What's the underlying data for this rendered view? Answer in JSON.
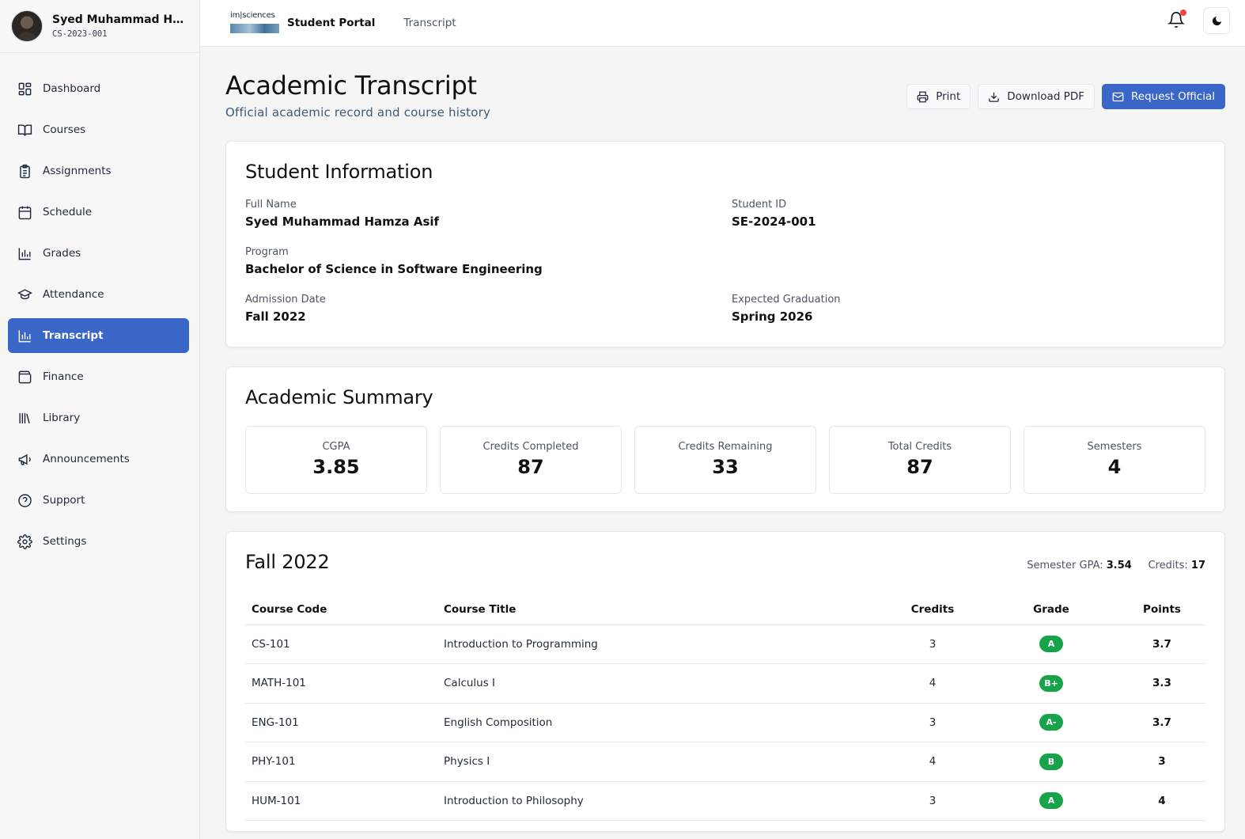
{
  "user": {
    "name": "Syed Muhammad Hamz...",
    "id": "CS-2023-001"
  },
  "sidebar": {
    "items": [
      {
        "label": "Dashboard",
        "icon": "dashboard-icon"
      },
      {
        "label": "Courses",
        "icon": "book-icon"
      },
      {
        "label": "Assignments",
        "icon": "clipboard-icon"
      },
      {
        "label": "Schedule",
        "icon": "calendar-icon"
      },
      {
        "label": "Grades",
        "icon": "bar-chart-icon"
      },
      {
        "label": "Attendance",
        "icon": "graduation-cap-icon"
      },
      {
        "label": "Transcript",
        "icon": "bar-chart-icon",
        "active": true
      },
      {
        "label": "Finance",
        "icon": "wallet-icon"
      },
      {
        "label": "Library",
        "icon": "library-icon"
      },
      {
        "label": "Announcements",
        "icon": "megaphone-icon"
      },
      {
        "label": "Support",
        "icon": "help-circle-icon"
      },
      {
        "label": "Settings",
        "icon": "gear-icon"
      }
    ]
  },
  "header": {
    "logo_text": "im|sciences",
    "portal_title": "Student Portal",
    "breadcrumb": "Transcript"
  },
  "page": {
    "title": "Academic Transcript",
    "subtitle": "Official academic record and course history",
    "actions": {
      "print": "Print",
      "download": "Download PDF",
      "request": "Request Official"
    }
  },
  "student_info": {
    "title": "Student Information",
    "full_name_label": "Full Name",
    "full_name": "Syed Muhammad Hamza Asif",
    "student_id_label": "Student ID",
    "student_id": "SE-2024-001",
    "program_label": "Program",
    "program": "Bachelor of Science in Software Engineering",
    "admission_label": "Admission Date",
    "admission": "Fall 2022",
    "graduation_label": "Expected Graduation",
    "graduation": "Spring 2026"
  },
  "summary": {
    "title": "Academic Summary",
    "stats": [
      {
        "label": "CGPA",
        "value": "3.85"
      },
      {
        "label": "Credits Completed",
        "value": "87"
      },
      {
        "label": "Credits Remaining",
        "value": "33"
      },
      {
        "label": "Total Credits",
        "value": "87"
      },
      {
        "label": "Semesters",
        "value": "4"
      }
    ]
  },
  "semester": {
    "title": "Fall 2022",
    "gpa_label": "Semester GPA:",
    "gpa": "3.54",
    "credits_label": "Credits:",
    "credits": "17",
    "columns": [
      "Course Code",
      "Course Title",
      "Credits",
      "Grade",
      "Points"
    ],
    "rows": [
      {
        "code": "CS-101",
        "title": "Introduction to Programming",
        "credits": "3",
        "grade": "A",
        "points": "3.7"
      },
      {
        "code": "MATH-101",
        "title": "Calculus I",
        "credits": "4",
        "grade": "B+",
        "points": "3.3"
      },
      {
        "code": "ENG-101",
        "title": "English Composition",
        "credits": "3",
        "grade": "A-",
        "points": "3.7"
      },
      {
        "code": "PHY-101",
        "title": "Physics I",
        "credits": "4",
        "grade": "B",
        "points": "3"
      },
      {
        "code": "HUM-101",
        "title": "Introduction to Philosophy",
        "credits": "3",
        "grade": "A",
        "points": "4"
      }
    ]
  },
  "colors": {
    "accent": "#3a66c8",
    "grade_badge": "#16a34a",
    "notification_dot": "#ef4444"
  }
}
